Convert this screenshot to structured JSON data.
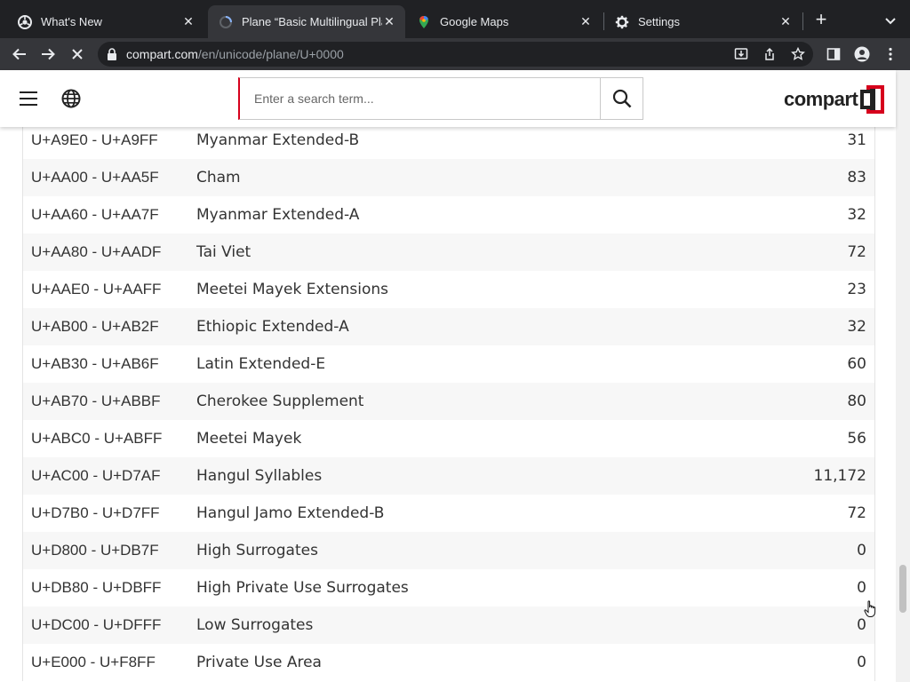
{
  "browser": {
    "tabs": [
      {
        "title": "What's New",
        "icon": "chrome-icon",
        "active": false
      },
      {
        "title": "Plane “Basic Multilingual Pla",
        "icon": "loading-spinner-icon",
        "active": true
      },
      {
        "title": "Google Maps",
        "icon": "google-maps-icon",
        "active": false
      },
      {
        "title": "Settings",
        "icon": "gear-icon",
        "active": false
      }
    ],
    "new_tab_label": "+",
    "address": {
      "domain": "compart.com",
      "path": "/en/unicode/plane/U+0000"
    }
  },
  "site": {
    "search_placeholder": "Enter a search term...",
    "logo_text": "compart",
    "brand_color": "#d6001c"
  },
  "blocks": [
    {
      "range": "U+A9E0 - U+A9FF",
      "name": "Myanmar Extended-B",
      "count": "31"
    },
    {
      "range": "U+AA00 - U+AA5F",
      "name": "Cham",
      "count": "83"
    },
    {
      "range": "U+AA60 - U+AA7F",
      "name": "Myanmar Extended-A",
      "count": "32"
    },
    {
      "range": "U+AA80 - U+AADF",
      "name": "Tai Viet",
      "count": "72"
    },
    {
      "range": "U+AAE0 - U+AAFF",
      "name": "Meetei Mayek Extensions",
      "count": "23"
    },
    {
      "range": "U+AB00 - U+AB2F",
      "name": "Ethiopic Extended-A",
      "count": "32"
    },
    {
      "range": "U+AB30 - U+AB6F",
      "name": "Latin Extended-E",
      "count": "60"
    },
    {
      "range": "U+AB70 - U+ABBF",
      "name": "Cherokee Supplement",
      "count": "80"
    },
    {
      "range": "U+ABC0 - U+ABFF",
      "name": "Meetei Mayek",
      "count": "56"
    },
    {
      "range": "U+AC00 - U+D7AF",
      "name": "Hangul Syllables",
      "count": "11,172"
    },
    {
      "range": "U+D7B0 - U+D7FF",
      "name": "Hangul Jamo Extended-B",
      "count": "72"
    },
    {
      "range": "U+D800 - U+DB7F",
      "name": "High Surrogates",
      "count": "0"
    },
    {
      "range": "U+DB80 - U+DBFF",
      "name": "High Private Use Surrogates",
      "count": "0"
    },
    {
      "range": "U+DC00 - U+DFFF",
      "name": "Low Surrogates",
      "count": "0"
    },
    {
      "range": "U+E000 - U+F8FF",
      "name": "Private Use Area",
      "count": "0"
    }
  ]
}
